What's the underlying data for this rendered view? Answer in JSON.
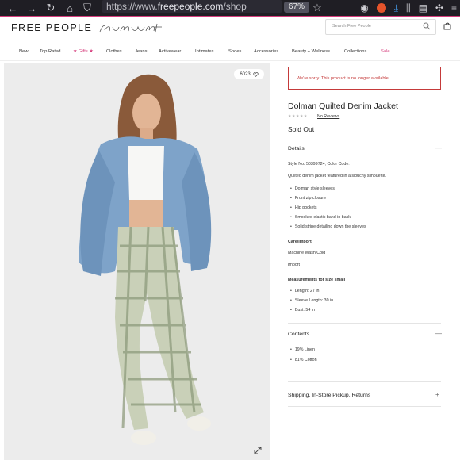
{
  "browser": {
    "url_prefix": "https://www.",
    "url_domain": "freepeople.com",
    "url_rest": "/shop",
    "zoom": "67%",
    "icons": [
      "back-arrow-icon",
      "forward-arrow-icon",
      "reload-icon",
      "home-icon",
      "shield-icon",
      "settings-icon",
      "star-icon",
      "pocket-icon",
      "download-icon",
      "library-icon",
      "reader-icon",
      "extension-icon",
      "menu-icon"
    ]
  },
  "site": {
    "logo": "FREE PEOPLE",
    "sub_logo": "FP Movement",
    "search_placeholder": "Search Free People"
  },
  "nav": [
    "New",
    "Top Rated",
    "★ Gifts ★",
    "Clothes",
    "Jeans",
    "Activewear",
    "Intimates",
    "Shoes",
    "Accessories",
    "Beauty + Wellness",
    "Collections",
    "Sale"
  ],
  "gallery": {
    "count": "6023"
  },
  "product": {
    "alert": "We're sorry. This product is no longer available.",
    "title": "Dolman Quilted Denim Jacket",
    "stars": "★★★★★",
    "reviews": "No Reviews",
    "status": "Sold Out",
    "details_heading": "Details",
    "style_line": "Style No. 50399724; Color Code:",
    "description": "Quilted denim jacket featured in a slouchy silhouette.",
    "features": [
      "Dolman style sleeves",
      "Front zip closure",
      "Hip pockets",
      "Smocked elastic band in back",
      "Solid stripe detailing down the sleeves"
    ],
    "care_heading": "Care/Import",
    "care": "Machine Wash Cold",
    "import": "Import",
    "measure_heading": "Measurements for size small",
    "measurements": [
      "Length: 27 in",
      "Sleeve Length: 30 in",
      "Bust: 54 in"
    ],
    "contents_heading": "Contents",
    "contents": [
      "19% Linen",
      "81% Cotton"
    ],
    "shipping_heading": "Shipping, In-Store Pickup, Returns",
    "toggle_open": "—",
    "toggle_closed": "+"
  },
  "colors": {
    "accent": "#d63c7c",
    "alert": "#c53a3a"
  }
}
